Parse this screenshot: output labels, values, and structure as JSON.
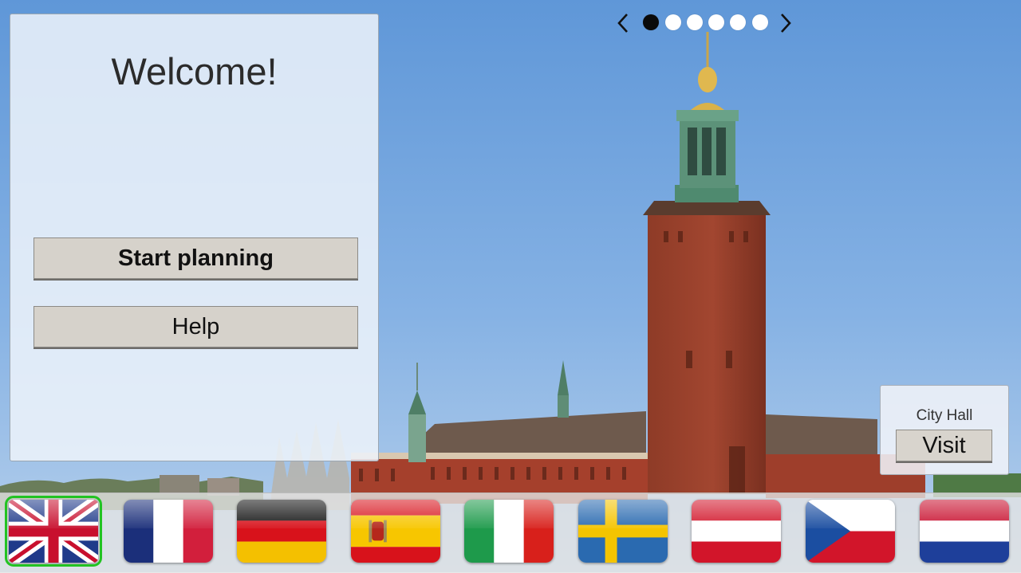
{
  "welcome": {
    "title": "Welcome!",
    "start_label": "Start planning",
    "help_label": "Help"
  },
  "carousel": {
    "slide_count": 6,
    "current_slide": 1,
    "prev_icon": "chevron-left-icon",
    "next_icon": "chevron-right-icon"
  },
  "attraction": {
    "name": "City Hall",
    "visit_label": "Visit"
  },
  "languages": {
    "selected": "english",
    "selected_color": "#22c322",
    "flags": [
      {
        "id": "english",
        "icon": "uk-flag-icon"
      },
      {
        "id": "french",
        "icon": "france-flag-icon"
      },
      {
        "id": "german",
        "icon": "germany-flag-icon"
      },
      {
        "id": "spanish",
        "icon": "spain-flag-icon"
      },
      {
        "id": "italian",
        "icon": "italy-flag-icon"
      },
      {
        "id": "swedish",
        "icon": "sweden-flag-icon"
      },
      {
        "id": "austrian",
        "icon": "austria-flag-icon"
      },
      {
        "id": "czech",
        "icon": "czech-flag-icon"
      },
      {
        "id": "dutch",
        "icon": "netherlands-flag-icon"
      }
    ]
  }
}
